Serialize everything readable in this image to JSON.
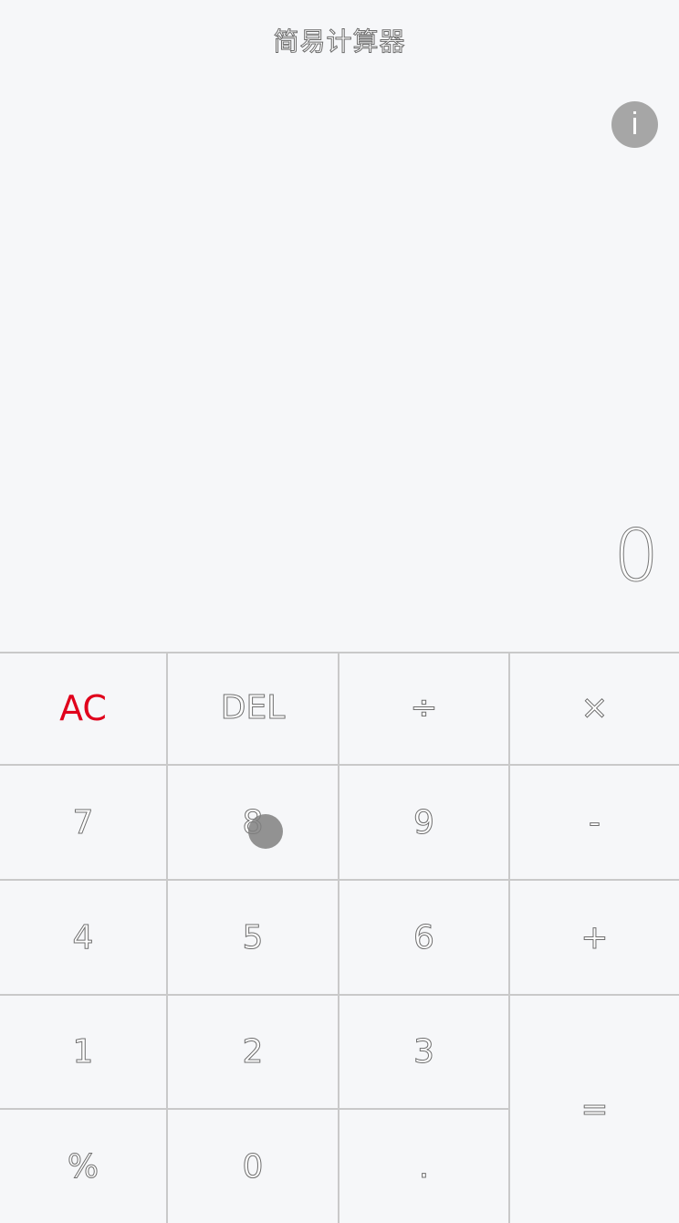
{
  "app": {
    "title": "简易计算器"
  },
  "info_button": {
    "label": "i"
  },
  "display": {
    "value": "0"
  },
  "keys": {
    "ac": "AC",
    "del": "DEL",
    "divide": "÷",
    "multiply": "×",
    "seven": "7",
    "eight": "8",
    "nine": "9",
    "minus": "-",
    "four": "4",
    "five": "5",
    "six": "6",
    "plus": "+",
    "one": "1",
    "two": "2",
    "three": "3",
    "equals": "=",
    "percent": "%",
    "zero": "0",
    "dot": "."
  },
  "colors": {
    "background": "#f6f7f9",
    "accent_ac": "#e0001b",
    "info_button": "#a6a6a6",
    "divider": "#c9c9c9"
  }
}
